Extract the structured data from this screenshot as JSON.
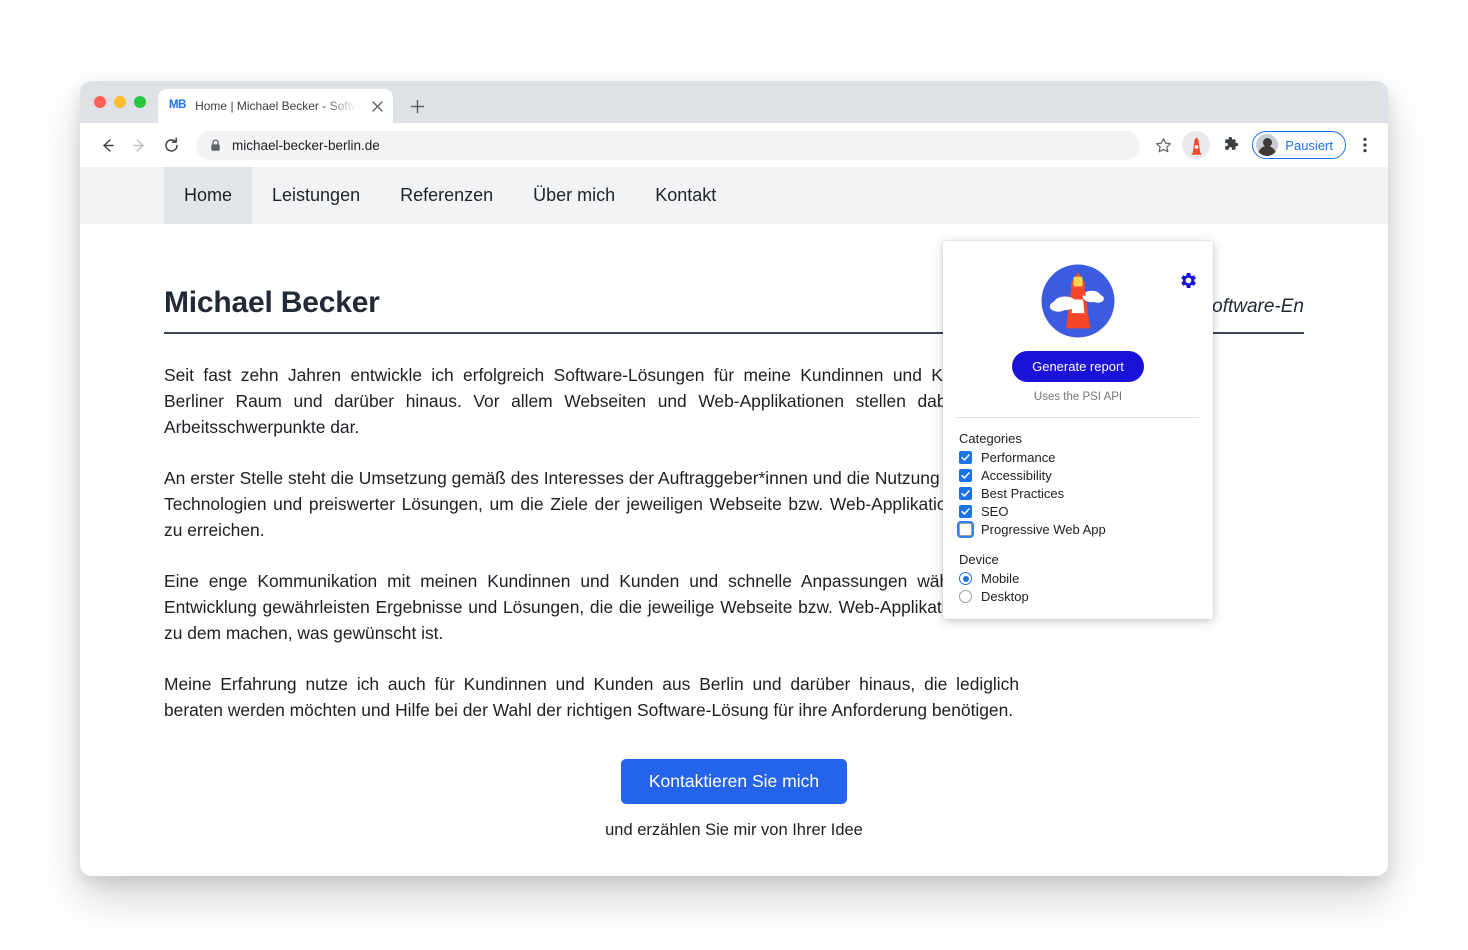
{
  "browser": {
    "tab": {
      "favicon_text": "MB",
      "title": "Home | Michael Becker - Softw",
      "close_icon": "close-icon",
      "new_tab_icon": "plus-icon"
    },
    "toolbar": {
      "back_icon": "back-arrow-icon",
      "forward_icon": "forward-arrow-icon",
      "reload_icon": "reload-icon",
      "lock_icon": "lock-icon",
      "url": "michael-becker-berlin.de",
      "star_icon": "star-icon",
      "extension_icon": "lighthouse-icon",
      "puzzle_icon": "puzzle-piece-icon",
      "profile_label": "Pausiert",
      "menu_icon": "three-dot-menu-icon"
    }
  },
  "site": {
    "nav": [
      {
        "label": "Home",
        "active": true
      },
      {
        "label": "Leistungen",
        "active": false
      },
      {
        "label": "Referenzen",
        "active": false
      },
      {
        "label": "Über mich",
        "active": false
      },
      {
        "label": "Kontakt",
        "active": false
      }
    ],
    "title": "Michael Becker",
    "subtitle": "Software-En",
    "paragraphs": [
      "Seit fast zehn Jahren entwickle ich erfolgreich Software-Lösungen für meine Kundinnen und Kunden im Berliner Raum und darüber hinaus. Vor allem Webseiten und Web-Applikationen stellen dabei meine Arbeitsschwerpunkte dar.",
      "An erster Stelle steht die Umsetzung gemäß des Interesses der Auftraggeber*innen und die Nutzung moderner Technologien und preiswerter Lösungen, um die Ziele der jeweiligen Webseite bzw. Web-Applikation optimal zu erreichen.",
      "Eine enge Kommunikation mit meinen Kundinnen und Kunden und schnelle Anpassungen während der Entwicklung gewährleisten Ergebnisse und Lösungen, die die jeweilige Webseite bzw. Web-Applikation genau zu dem machen, was gewünscht ist.",
      "Meine Erfahrung nutze ich auch für Kundinnen und Kunden aus Berlin und darüber hinaus, die lediglich beraten werden möchten und Hilfe bei der Wahl der richtigen Software-Lösung für ihre Anforderung benötigen."
    ],
    "cta_button": "Kontaktieren Sie mich",
    "cta_subtext": "und erzählen Sie mir von Ihrer Idee"
  },
  "lighthouse_popup": {
    "settings_icon": "gear-icon",
    "logo_icon": "lighthouse-logo-icon",
    "generate_button": "Generate report",
    "psi_note": "Uses the PSI API",
    "categories_title": "Categories",
    "categories": [
      {
        "label": "Performance",
        "checked": true
      },
      {
        "label": "Accessibility",
        "checked": true
      },
      {
        "label": "Best Practices",
        "checked": true
      },
      {
        "label": "SEO",
        "checked": true
      },
      {
        "label": "Progressive Web App",
        "checked": false
      }
    ],
    "device_title": "Device",
    "devices": [
      {
        "label": "Mobile",
        "selected": true
      },
      {
        "label": "Desktop",
        "selected": false
      }
    ]
  },
  "colors": {
    "accent_blue": "#1a73e8",
    "cta_blue": "#2563eb",
    "generate_blue": "#1a12d8",
    "tabstrip_gray": "#dee1e6",
    "sitenav_gray": "#f1f3f5"
  }
}
